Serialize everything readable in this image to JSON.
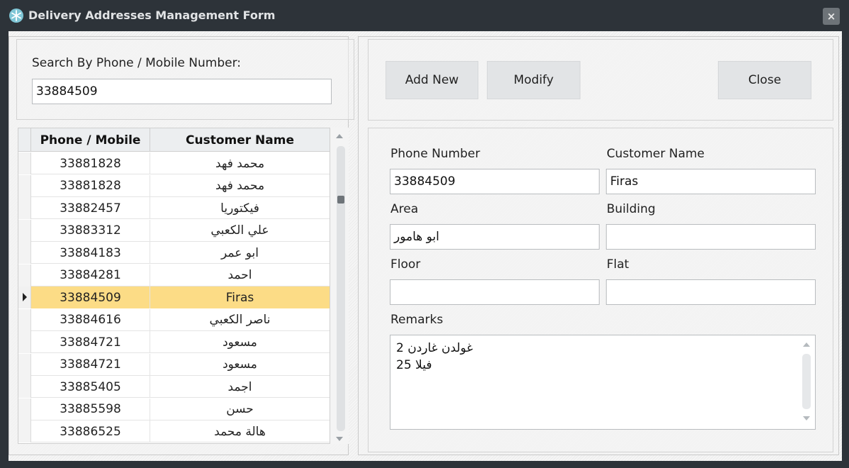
{
  "window": {
    "title": "Delivery Addresses Management Form",
    "icon": "snowflake-icon",
    "close_glyph": "×"
  },
  "search": {
    "label": "Search By Phone / Mobile Number:",
    "value": "33884509"
  },
  "grid": {
    "columns": [
      "Phone / Mobile",
      "Customer Name"
    ],
    "selected_index": 6,
    "rows": [
      {
        "phone": "33881828",
        "name": "محمد فهد"
      },
      {
        "phone": "33881828",
        "name": "محمد فهد"
      },
      {
        "phone": "33882457",
        "name": "فيكتوريا"
      },
      {
        "phone": "33883312",
        "name": "علي الكعبي"
      },
      {
        "phone": "33884183",
        "name": "ابو عمر"
      },
      {
        "phone": "33884281",
        "name": "احمد"
      },
      {
        "phone": "33884509",
        "name": "Firas"
      },
      {
        "phone": "33884616",
        "name": "ناصر الكعبي"
      },
      {
        "phone": "33884721",
        "name": "مسعود"
      },
      {
        "phone": "33884721",
        "name": "مسعود"
      },
      {
        "phone": "33885405",
        "name": "اجمد"
      },
      {
        "phone": "33885598",
        "name": "حسن"
      },
      {
        "phone": "33886525",
        "name": "هالة محمد"
      }
    ]
  },
  "toolbar": {
    "add_label": "Add New",
    "modify_label": "Modify",
    "close_label": "Close"
  },
  "form": {
    "phone_label": "Phone Number",
    "phone_value": "33884509",
    "name_label": "Customer Name",
    "name_value": "Firas",
    "area_label": "Area",
    "area_value": "ابو هامور",
    "building_label": "Building",
    "building_value": "",
    "floor_label": "Floor",
    "floor_value": "",
    "flat_label": "Flat",
    "flat_value": "",
    "remarks_label": "Remarks",
    "remarks_lines": [
      "غولدن غاردن 2",
      "فيلا 25"
    ]
  },
  "colors": {
    "titlebar": "#2d3339",
    "selected_row": "#fcdc86",
    "button": "#e2e4e6",
    "icon_accent": "#7fc6d6"
  }
}
